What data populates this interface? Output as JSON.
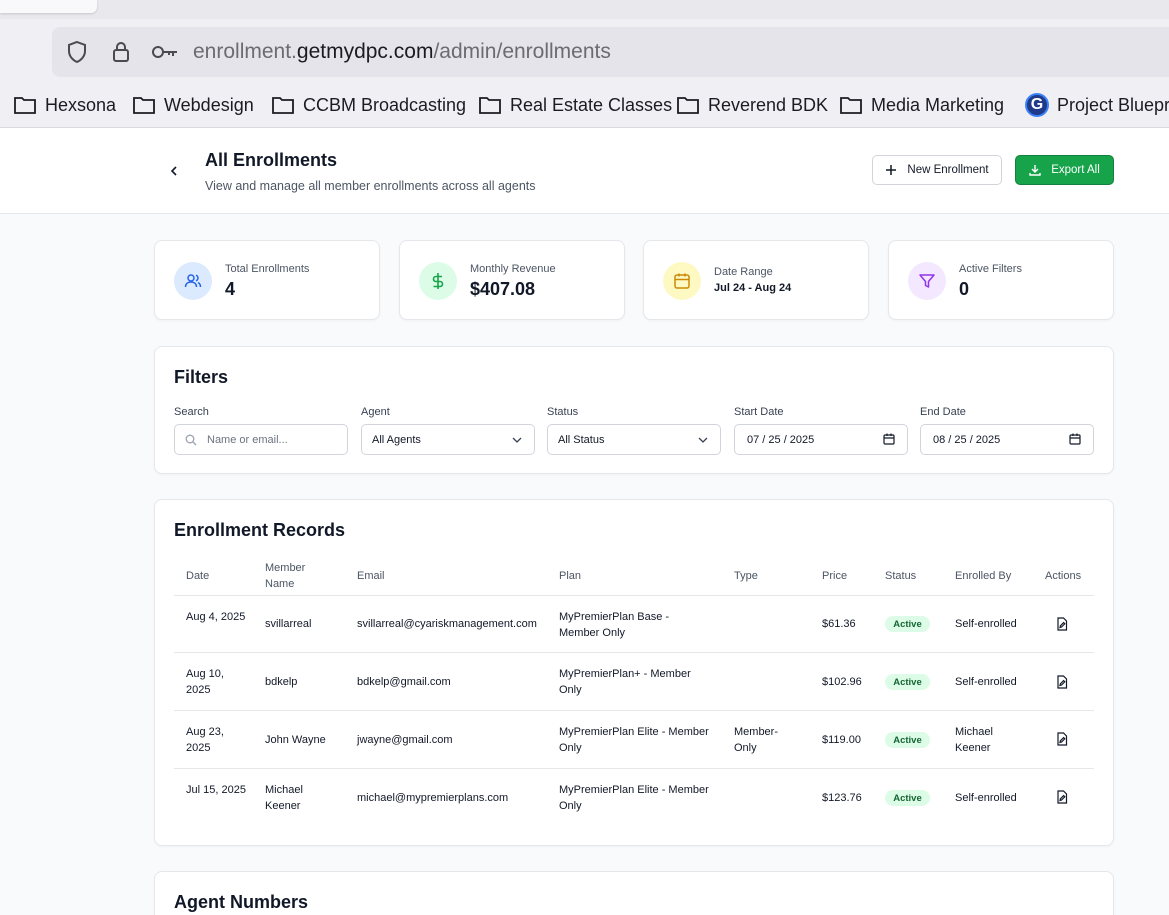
{
  "browser": {
    "url_prefix": "enrollment.",
    "url_domain": "getmydpc.com",
    "url_path": "/admin/enrollments",
    "bookmarks": [
      "Hexsona",
      "Webdesign",
      "CCBM Broadcasting",
      "Real Estate Classes",
      "Reverend BDK",
      "Media Marketing",
      "Project Bluepri"
    ],
    "bookmark_logo_letter": "G"
  },
  "header": {
    "title": "All Enrollments",
    "subtitle": "View and manage all member enrollments across all agents",
    "new_button": "New Enrollment",
    "export_button": "Export All"
  },
  "stats": [
    {
      "label": "Total Enrollments",
      "value": "4",
      "icon": "users-icon",
      "color": "#2563eb",
      "bg": "#dbeafe"
    },
    {
      "label": "Monthly Revenue",
      "value": "$407.08",
      "icon": "dollar-icon",
      "color": "#16a34a",
      "bg": "#dcfce7"
    },
    {
      "label": "Date Range",
      "value": "Jul 24 - Aug 24",
      "icon": "calendar-icon",
      "color": "#ca8a04",
      "bg": "#fef9c3"
    },
    {
      "label": "Active Filters",
      "value": "0",
      "icon": "filter-icon",
      "color": "#9333ea",
      "bg": "#f3e8ff"
    }
  ],
  "filters": {
    "title": "Filters",
    "search_label": "Search",
    "search_placeholder": "Name or email...",
    "agent_label": "Agent",
    "agent_value": "All Agents",
    "status_label": "Status",
    "status_value": "All Status",
    "start_label": "Start Date",
    "start_value": "07 / 25 / 2025",
    "end_label": "End Date",
    "end_value": "08 / 25 / 2025"
  },
  "records": {
    "title": "Enrollment Records",
    "columns": [
      "Date",
      "Member Name",
      "Email",
      "Plan",
      "Type",
      "Price",
      "Status",
      "Enrolled By",
      "Actions"
    ],
    "rows": [
      {
        "date": "Aug 4, 2025",
        "name": "svillarreal",
        "email": "svillarreal@cyariskmanagement.com",
        "plan": "MyPremierPlan Base - Member Only",
        "type": "",
        "price": "$61.36",
        "status": "Active",
        "enrolled_by": "Self-enrolled"
      },
      {
        "date": "Aug 10, 2025",
        "name": "bdkelp",
        "email": "bdkelp@gmail.com",
        "plan": "MyPremierPlan+ - Member Only",
        "type": "",
        "price": "$102.96",
        "status": "Active",
        "enrolled_by": "Self-enrolled"
      },
      {
        "date": "Aug 23, 2025",
        "name": "John Wayne",
        "email": "jwayne@gmail.com",
        "plan": "MyPremierPlan Elite - Member Only",
        "type": "Member-Only",
        "price": "$119.00",
        "status": "Active",
        "enrolled_by": "Michael Keener"
      },
      {
        "date": "Jul 15, 2025",
        "name": "Michael Keener",
        "email": "michael@mypremierplans.com",
        "plan": "MyPremierPlan Elite - Member Only",
        "type": "",
        "price": "$123.76",
        "status": "Active",
        "enrolled_by": "Self-enrolled"
      }
    ]
  },
  "agent_numbers": {
    "title": "Agent Numbers"
  }
}
